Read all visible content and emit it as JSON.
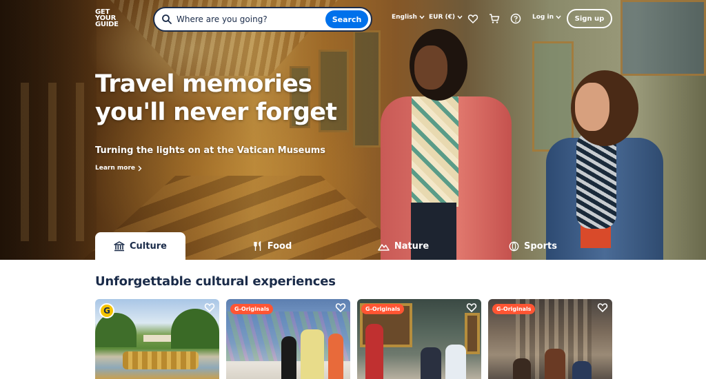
{
  "header": {
    "logo_lines": [
      "GET",
      "YOUR",
      "GUIDE"
    ],
    "search": {
      "placeholder": "Where are you going?",
      "button_label": "Search"
    },
    "language": "English",
    "currency": "EUR (€)",
    "login": "Log in",
    "signup": "Sign up"
  },
  "hero": {
    "headline_line1": "Travel memories",
    "headline_line2": "you'll never forget",
    "subheading": "Turning the lights on at the Vatican Museums",
    "learn_more": "Learn more"
  },
  "tabs": [
    {
      "label": "Culture",
      "icon": "museum-icon",
      "active": true
    },
    {
      "label": "Food",
      "icon": "fork-knife-icon",
      "active": false
    },
    {
      "label": "Nature",
      "icon": "mountain-icon",
      "active": false
    },
    {
      "label": "Sports",
      "icon": "ball-icon",
      "active": false
    }
  ],
  "section": {
    "title": "Unforgettable cultural experiences",
    "cards": [
      {
        "badge": "G"
      },
      {
        "badge": "G-Originals"
      },
      {
        "badge": "G-Originals"
      },
      {
        "badge": "G-Originals"
      }
    ]
  },
  "colors": {
    "brand_blue": "#0071eb",
    "navy_text": "#1a2b49",
    "originals_orange": "#ff5533",
    "badge_yellow": "#f6c400"
  }
}
